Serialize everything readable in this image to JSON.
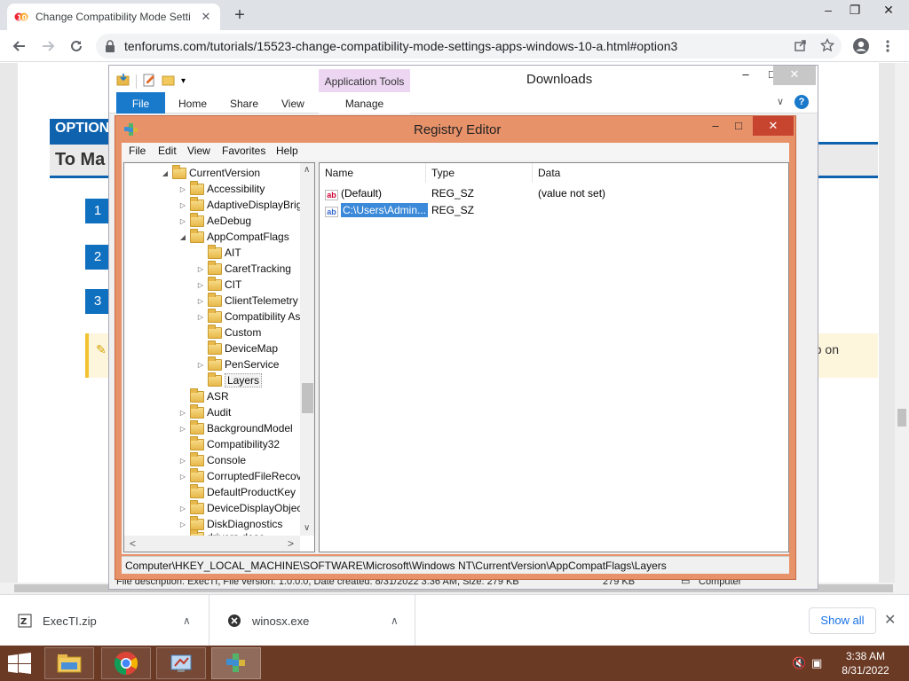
{
  "browser": {
    "tab_title": "Change Compatibility Mode Setti",
    "new_tab": "+",
    "url": "tenforums.com/tutorials/15523-change-compatibility-mode-settings-apps-windows-10-a.html#option3",
    "controls": {
      "minimize": "–",
      "restore": "❐",
      "close": "✕"
    }
  },
  "webpage": {
    "option_label": "OPTION",
    "heading": "To Ma",
    "steps": [
      "1",
      "2",
      "3"
    ],
    "note_tail": "o on"
  },
  "explorer": {
    "window_title": "Downloads",
    "context_group": "Application Tools",
    "ribbon_tabs": {
      "file": "File",
      "home": "Home",
      "share": "Share",
      "view": "View",
      "manage": "Manage"
    },
    "status_left": "File description: ExecTI, File version: 1.0.0.0, Date created: 8/31/2022 3:36 AM, Size: 279 KB",
    "status_size": "279 KB",
    "status_location": "Computer"
  },
  "regedit": {
    "title": "Registry Editor",
    "menu": [
      "File",
      "Edit",
      "View",
      "Favorites",
      "Help"
    ],
    "tree": [
      {
        "label": "CurrentVersion",
        "expander": "◢"
      },
      {
        "label": "Accessibility",
        "expander": "▷"
      },
      {
        "label": "AdaptiveDisplayBrightness",
        "expander": "▷"
      },
      {
        "label": "AeDebug",
        "expander": "▷"
      },
      {
        "label": "AppCompatFlags",
        "expander": "◢"
      },
      {
        "label": "AIT",
        "expander": ""
      },
      {
        "label": "CaretTracking",
        "expander": "▷"
      },
      {
        "label": "CIT",
        "expander": "▷"
      },
      {
        "label": "ClientTelemetry",
        "expander": "▷"
      },
      {
        "label": "Compatibility Assistant",
        "expander": "▷"
      },
      {
        "label": "Custom",
        "expander": ""
      },
      {
        "label": "DeviceMap",
        "expander": ""
      },
      {
        "label": "PenService",
        "expander": "▷"
      },
      {
        "label": "Layers",
        "expander": ""
      },
      {
        "label": "ASR",
        "expander": ""
      },
      {
        "label": "Audit",
        "expander": "▷"
      },
      {
        "label": "BackgroundModel",
        "expander": "▷"
      },
      {
        "label": "Compatibility32",
        "expander": ""
      },
      {
        "label": "Console",
        "expander": "▷"
      },
      {
        "label": "CorruptedFileRecovery",
        "expander": "▷"
      },
      {
        "label": "DefaultProductKey",
        "expander": ""
      },
      {
        "label": "DeviceDisplayObjects",
        "expander": "▷"
      },
      {
        "label": "DiskDiagnostics",
        "expander": "▷"
      },
      {
        "label": "drivers.desc",
        "expander": ""
      }
    ],
    "columns": {
      "name": "Name",
      "type": "Type",
      "data": "Data"
    },
    "values": [
      {
        "name": "(Default)",
        "type": "REG_SZ",
        "data": "(value not set)"
      },
      {
        "name": "C:\\Users\\Admin...",
        "type": "REG_SZ",
        "data": ""
      }
    ],
    "status_path": "Computer\\HKEY_LOCAL_MACHINE\\SOFTWARE\\Microsoft\\Windows NT\\CurrentVersion\\AppCompatFlags\\Layers"
  },
  "downloads": {
    "items": [
      {
        "filename": "ExecTI.zip"
      },
      {
        "filename": "winosx.exe"
      }
    ],
    "show_all": "Show all"
  },
  "taskbar": {
    "time": "3:38 AM",
    "date": "8/31/2022"
  },
  "colors": {
    "regedit_frame": "#e8926a",
    "regedit_close": "#c7442f",
    "selection": "#3b89d9",
    "taskbar": "#6b3a25",
    "page_accent": "#0f62ae"
  }
}
